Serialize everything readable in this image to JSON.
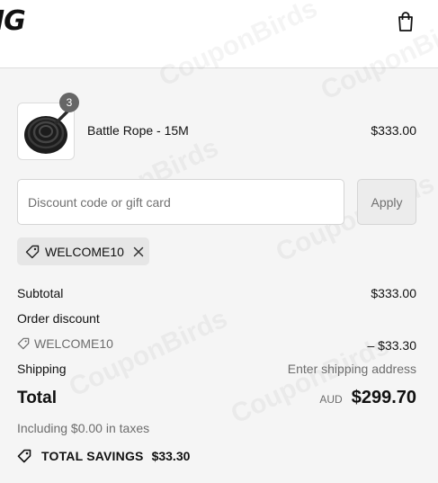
{
  "header": {
    "logo_text": "IG",
    "cart_icon": "shopping-bag-icon"
  },
  "product": {
    "name": "Battle Rope - 15M",
    "price": "$333.00",
    "quantity": "3",
    "image_icon": "battle-rope-coil-image"
  },
  "discount": {
    "placeholder": "Discount code or gift card",
    "apply_label": "Apply"
  },
  "applied_code": {
    "code": "WELCOME10",
    "tag_icon": "tag-icon",
    "remove_icon": "close-icon"
  },
  "summary": {
    "subtotal_label": "Subtotal",
    "subtotal_value": "$333.00",
    "order_discount_label": "Order discount",
    "discount_code": "WELCOME10",
    "discount_value": "– $33.30",
    "shipping_label": "Shipping",
    "shipping_value": "Enter shipping address",
    "total_label": "Total",
    "currency": "AUD",
    "total_value": "$299.70",
    "taxes_note": "Including $0.00 in taxes",
    "savings_label": "TOTAL SAVINGS",
    "savings_value": "$33.30"
  },
  "watermark": "CouponBirds"
}
